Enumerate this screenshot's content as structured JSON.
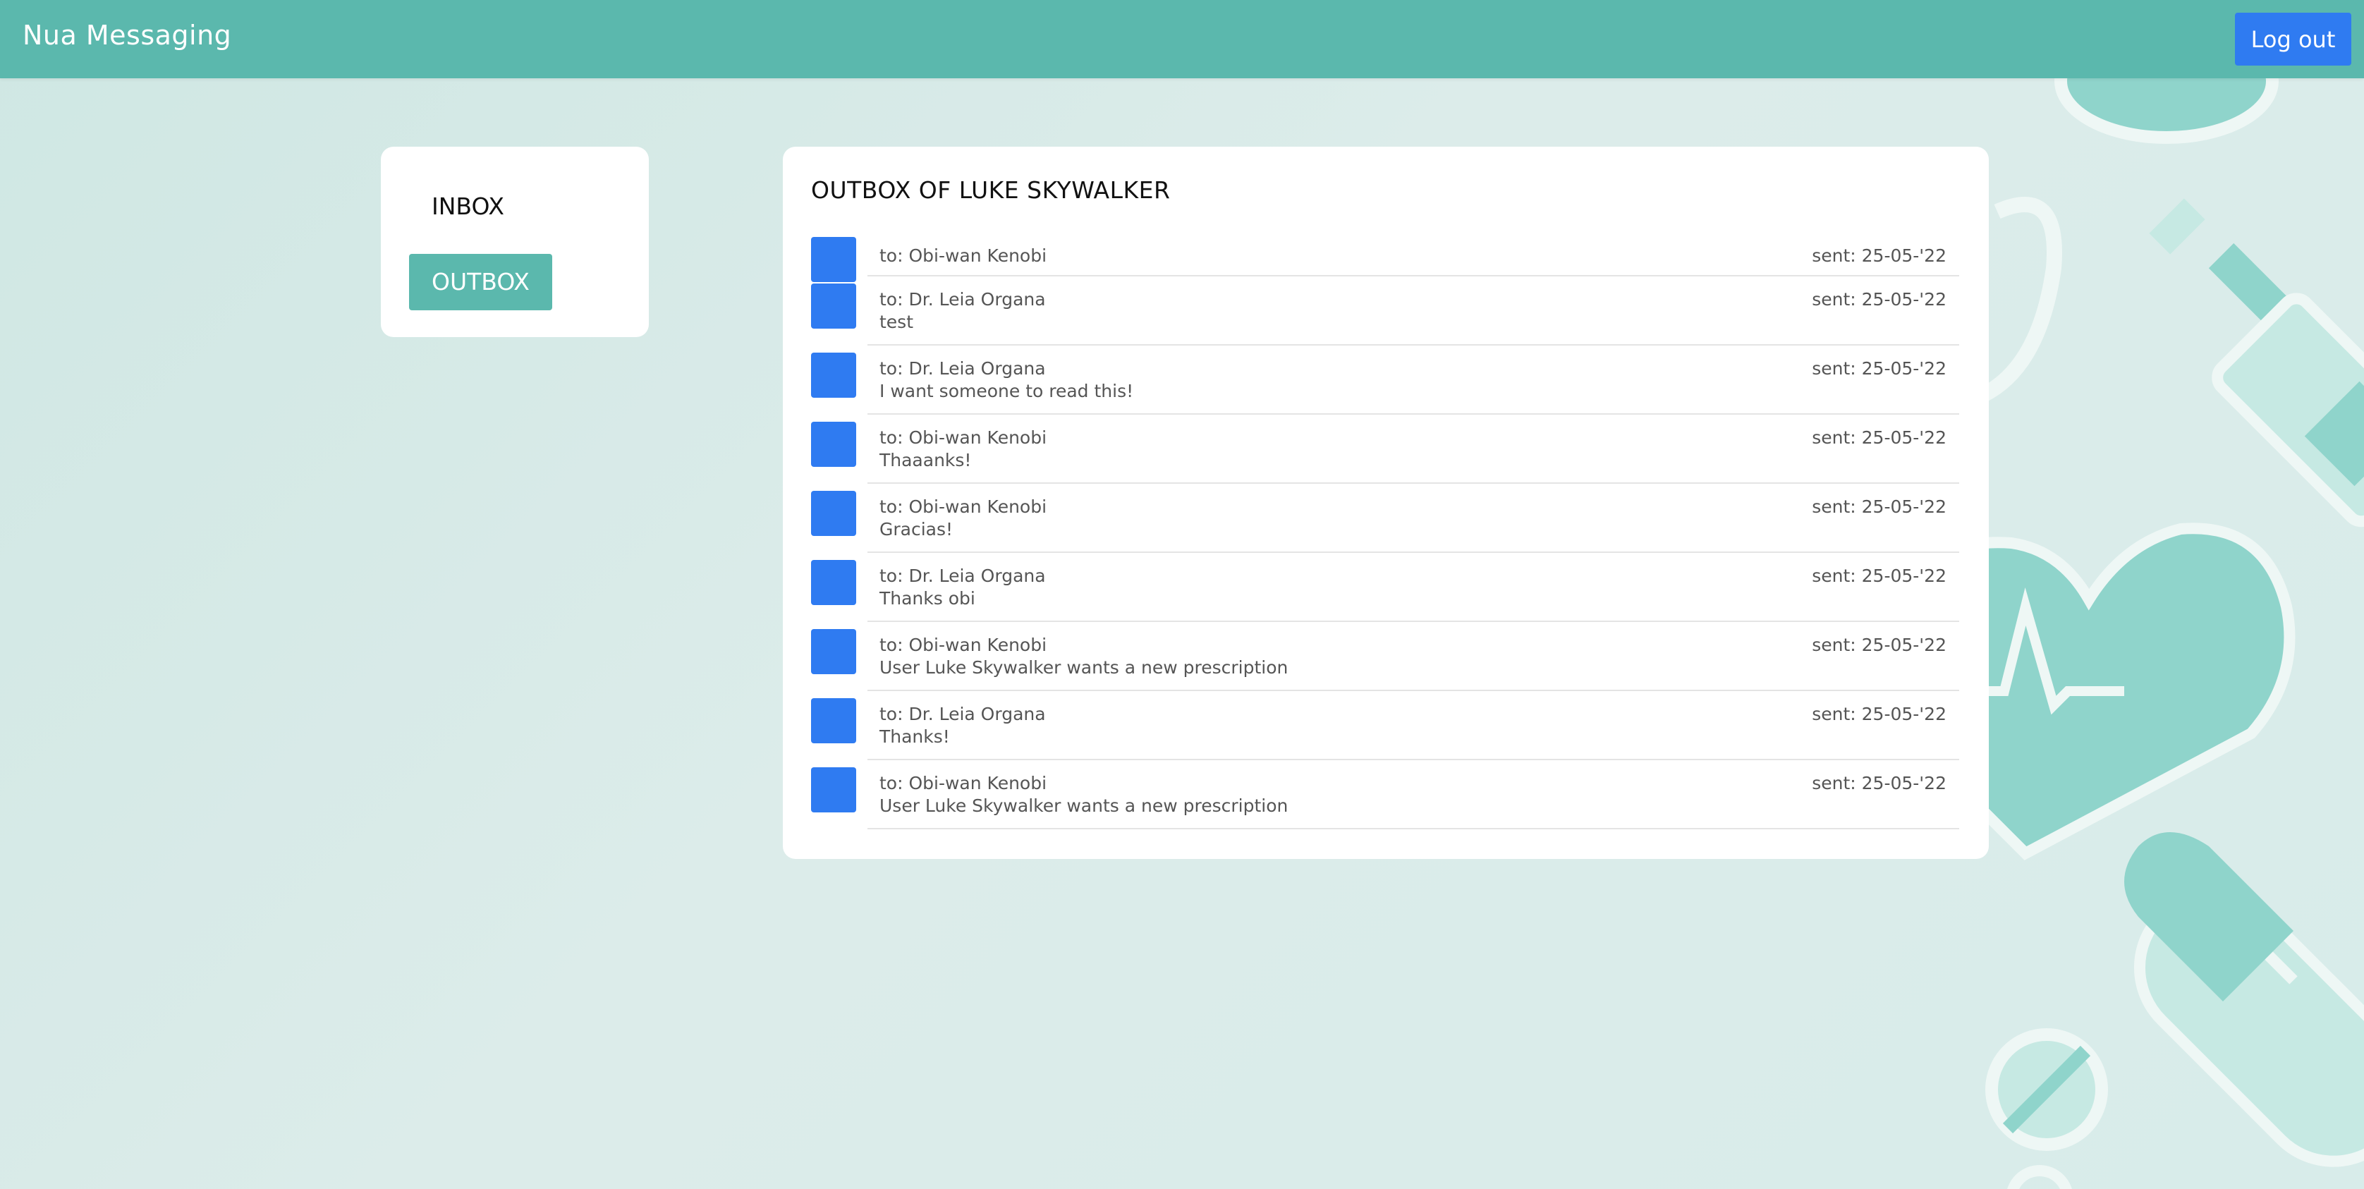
{
  "header": {
    "brand": "Nua Messaging",
    "logout_label": "Log out"
  },
  "sidebar": {
    "items": [
      {
        "label": "INBOX",
        "active": false
      },
      {
        "label": "OUTBOX",
        "active": true
      }
    ]
  },
  "outbox": {
    "title": "OUTBOX OF LUKE SKYWALKER",
    "messages": [
      {
        "to": "to: Obi-wan Kenobi",
        "body": "",
        "sent": "sent: 25-05-'22"
      },
      {
        "to": "to: Dr. Leia Organa",
        "body": "test",
        "sent": "sent: 25-05-'22"
      },
      {
        "to": "to: Dr. Leia Organa",
        "body": "I want someone to read this!",
        "sent": "sent: 25-05-'22"
      },
      {
        "to": "to: Obi-wan Kenobi",
        "body": "Thaaanks!",
        "sent": "sent: 25-05-'22"
      },
      {
        "to": "to: Obi-wan Kenobi",
        "body": "Gracias!",
        "sent": "sent: 25-05-'22"
      },
      {
        "to": "to: Dr. Leia Organa",
        "body": "Thanks obi",
        "sent": "sent: 25-05-'22"
      },
      {
        "to": "to: Obi-wan Kenobi",
        "body": "User Luke Skywalker wants a new prescription",
        "sent": "sent: 25-05-'22"
      },
      {
        "to": "to: Dr. Leia Organa",
        "body": "Thanks!",
        "sent": "sent: 25-05-'22"
      },
      {
        "to": "to: Obi-wan Kenobi",
        "body": "User Luke Skywalker wants a new prescription",
        "sent": "sent: 25-05-'22"
      }
    ]
  },
  "colors": {
    "header_bg": "#5bb8ad",
    "accent_blue": "#2f7bf1",
    "active_tab_bg": "#5bb8ad",
    "background_teal": "#8fd4cb"
  },
  "decorations": {
    "icons": [
      "stethoscope-icon",
      "syringe-icon",
      "heart-pulse-icon",
      "pill-capsule-icon",
      "pill-tablet-icon"
    ]
  }
}
